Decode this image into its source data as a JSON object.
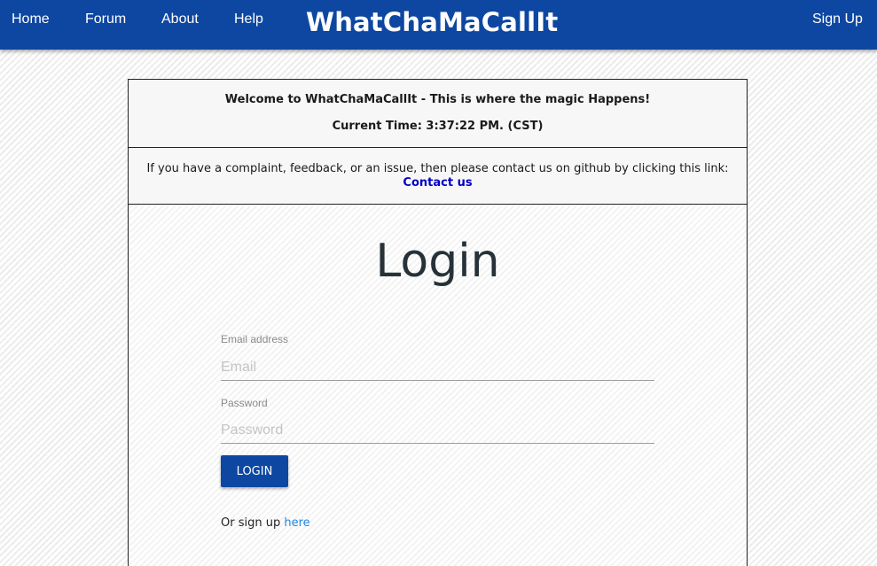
{
  "nav": {
    "home": "Home",
    "forum": "Forum",
    "about": "About",
    "help": "Help",
    "brand": "WhatChaMaCallIt",
    "signup": "Sign Up"
  },
  "banner": {
    "welcome": "Welcome to WhatChaMaCallIt - This is where the magic Happens!",
    "time": "Current Time: 3:37:22 PM. (CST)",
    "contact_text": "If you have a complaint, feedback, or an issue, then please contact us on github by clicking this link:",
    "contact_link": "Contact us"
  },
  "login": {
    "title": "Login",
    "email_label": "Email address",
    "email_placeholder": "Email",
    "password_label": "Password",
    "password_placeholder": "Password",
    "button": "LOGIN",
    "signup_prefix": "Or sign up ",
    "signup_link": "here"
  },
  "colors": {
    "navbar": "#0d47a1",
    "button": "#0d47a1",
    "link": "#0000c8",
    "signup_link": "#1e88e5"
  }
}
